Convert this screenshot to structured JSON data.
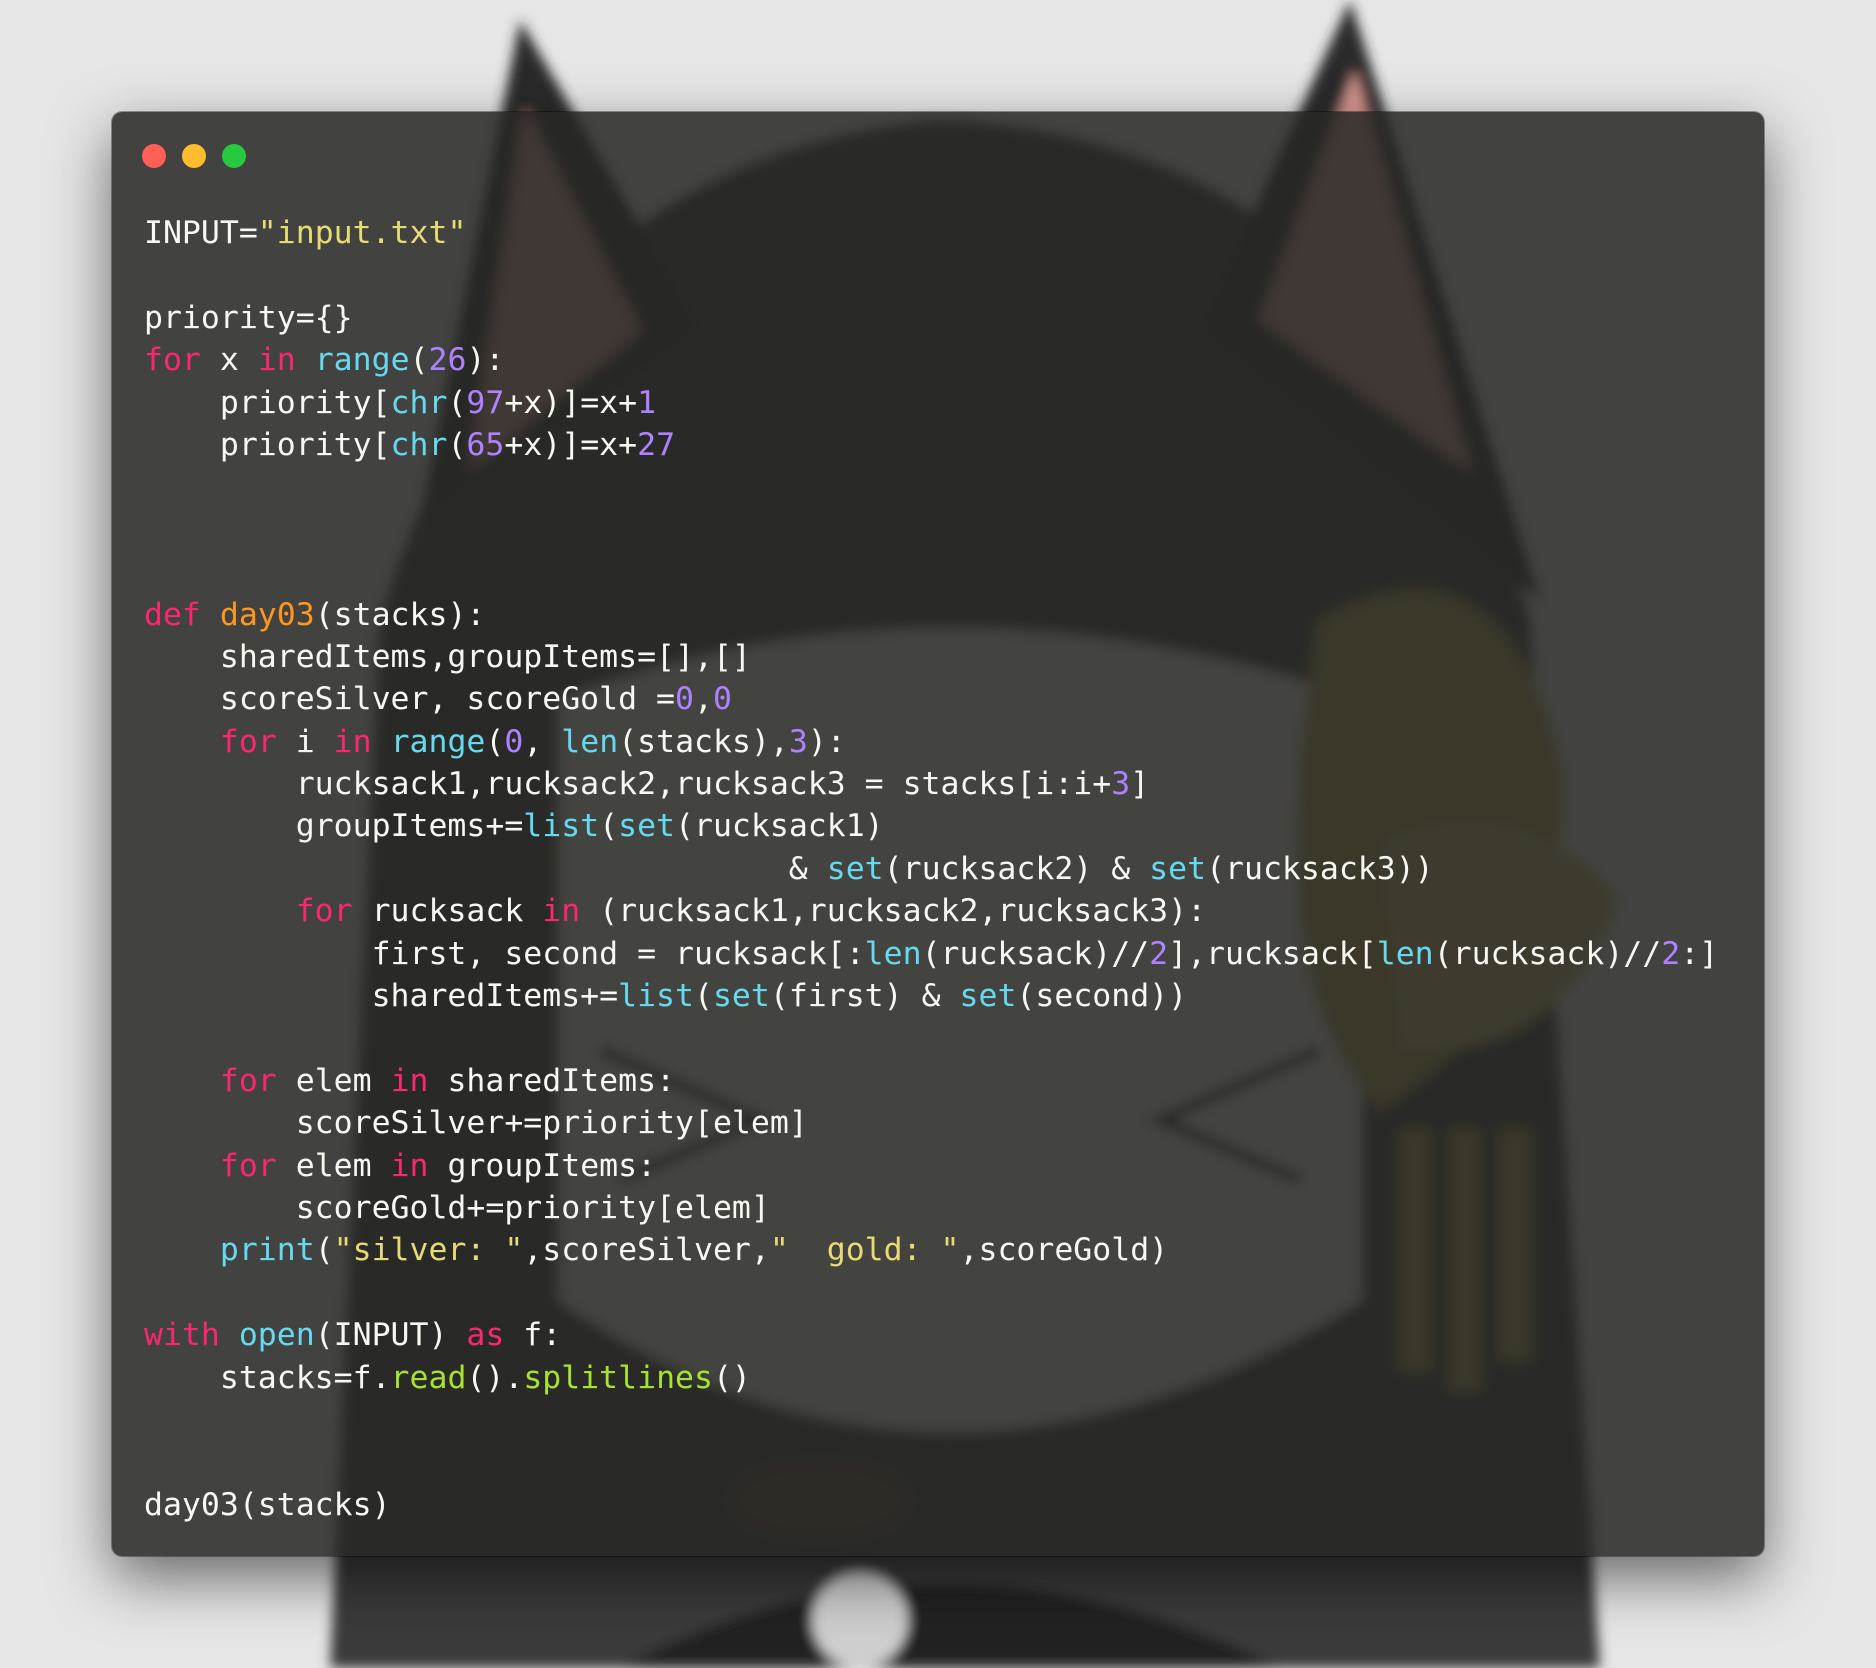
{
  "window": {
    "controls": {
      "close_color": "#ff5f56",
      "minimize_color": "#ffbd2e",
      "maximize_color": "#27c93f"
    }
  },
  "colors": {
    "keyword": "#f92672",
    "function_name": "#fd971f",
    "builtin": "#66d9ef",
    "number": "#ae81ff",
    "string": "#e6db74",
    "method": "#a6e22e",
    "text": "#f8f8f2"
  },
  "code": {
    "language": "python",
    "lines": [
      [
        {
          "t": "plain",
          "s": "INPUT="
        },
        {
          "t": "str",
          "s": "\"input.txt\""
        }
      ],
      [],
      [
        {
          "t": "plain",
          "s": "priority={}"
        }
      ],
      [
        {
          "t": "kw",
          "s": "for"
        },
        {
          "t": "plain",
          "s": " x "
        },
        {
          "t": "kw",
          "s": "in"
        },
        {
          "t": "plain",
          "s": " "
        },
        {
          "t": "bi",
          "s": "range"
        },
        {
          "t": "plain",
          "s": "("
        },
        {
          "t": "num",
          "s": "26"
        },
        {
          "t": "plain",
          "s": "):"
        }
      ],
      [
        {
          "t": "plain",
          "s": "    priority["
        },
        {
          "t": "bi",
          "s": "chr"
        },
        {
          "t": "plain",
          "s": "("
        },
        {
          "t": "num",
          "s": "97"
        },
        {
          "t": "plain",
          "s": "+x)]=x+"
        },
        {
          "t": "num",
          "s": "1"
        }
      ],
      [
        {
          "t": "plain",
          "s": "    priority["
        },
        {
          "t": "bi",
          "s": "chr"
        },
        {
          "t": "plain",
          "s": "("
        },
        {
          "t": "num",
          "s": "65"
        },
        {
          "t": "plain",
          "s": "+x)]=x+"
        },
        {
          "t": "num",
          "s": "27"
        }
      ],
      [],
      [],
      [],
      [
        {
          "t": "kw",
          "s": "def"
        },
        {
          "t": "plain",
          "s": " "
        },
        {
          "t": "fn",
          "s": "day03"
        },
        {
          "t": "plain",
          "s": "(stacks):"
        }
      ],
      [
        {
          "t": "plain",
          "s": "    sharedItems,groupItems=[],[]"
        }
      ],
      [
        {
          "t": "plain",
          "s": "    scoreSilver, scoreGold ="
        },
        {
          "t": "num",
          "s": "0"
        },
        {
          "t": "plain",
          "s": ","
        },
        {
          "t": "num",
          "s": "0"
        }
      ],
      [
        {
          "t": "plain",
          "s": "    "
        },
        {
          "t": "kw",
          "s": "for"
        },
        {
          "t": "plain",
          "s": " i "
        },
        {
          "t": "kw",
          "s": "in"
        },
        {
          "t": "plain",
          "s": " "
        },
        {
          "t": "bi",
          "s": "range"
        },
        {
          "t": "plain",
          "s": "("
        },
        {
          "t": "num",
          "s": "0"
        },
        {
          "t": "plain",
          "s": ", "
        },
        {
          "t": "bi",
          "s": "len"
        },
        {
          "t": "plain",
          "s": "(stacks),"
        },
        {
          "t": "num",
          "s": "3"
        },
        {
          "t": "plain",
          "s": "):"
        }
      ],
      [
        {
          "t": "plain",
          "s": "        rucksack1,rucksack2,rucksack3 = stacks[i:i+"
        },
        {
          "t": "num",
          "s": "3"
        },
        {
          "t": "plain",
          "s": "]"
        }
      ],
      [
        {
          "t": "plain",
          "s": "        groupItems+="
        },
        {
          "t": "bi",
          "s": "list"
        },
        {
          "t": "plain",
          "s": "("
        },
        {
          "t": "bi",
          "s": "set"
        },
        {
          "t": "plain",
          "s": "(rucksack1)"
        }
      ],
      [
        {
          "t": "plain",
          "s": "                                  & "
        },
        {
          "t": "bi",
          "s": "set"
        },
        {
          "t": "plain",
          "s": "(rucksack2) & "
        },
        {
          "t": "bi",
          "s": "set"
        },
        {
          "t": "plain",
          "s": "(rucksack3))"
        }
      ],
      [
        {
          "t": "plain",
          "s": "        "
        },
        {
          "t": "kw",
          "s": "for"
        },
        {
          "t": "plain",
          "s": " rucksack "
        },
        {
          "t": "kw",
          "s": "in"
        },
        {
          "t": "plain",
          "s": " (rucksack1,rucksack2,rucksack3):"
        }
      ],
      [
        {
          "t": "plain",
          "s": "            first, second = rucksack[:"
        },
        {
          "t": "bi",
          "s": "len"
        },
        {
          "t": "plain",
          "s": "(rucksack)//"
        },
        {
          "t": "num",
          "s": "2"
        },
        {
          "t": "plain",
          "s": "],rucksack["
        },
        {
          "t": "bi",
          "s": "len"
        },
        {
          "t": "plain",
          "s": "(rucksack)//"
        },
        {
          "t": "num",
          "s": "2"
        },
        {
          "t": "plain",
          "s": ":]"
        }
      ],
      [
        {
          "t": "plain",
          "s": "            sharedItems+="
        },
        {
          "t": "bi",
          "s": "list"
        },
        {
          "t": "plain",
          "s": "("
        },
        {
          "t": "bi",
          "s": "set"
        },
        {
          "t": "plain",
          "s": "(first) & "
        },
        {
          "t": "bi",
          "s": "set"
        },
        {
          "t": "plain",
          "s": "(second))"
        }
      ],
      [],
      [
        {
          "t": "plain",
          "s": "    "
        },
        {
          "t": "kw",
          "s": "for"
        },
        {
          "t": "plain",
          "s": " elem "
        },
        {
          "t": "kw",
          "s": "in"
        },
        {
          "t": "plain",
          "s": " sharedItems:"
        }
      ],
      [
        {
          "t": "plain",
          "s": "        scoreSilver+=priority[elem]"
        }
      ],
      [
        {
          "t": "plain",
          "s": "    "
        },
        {
          "t": "kw",
          "s": "for"
        },
        {
          "t": "plain",
          "s": " elem "
        },
        {
          "t": "kw",
          "s": "in"
        },
        {
          "t": "plain",
          "s": " groupItems:"
        }
      ],
      [
        {
          "t": "plain",
          "s": "        scoreGold+=priority[elem]"
        }
      ],
      [
        {
          "t": "plain",
          "s": "    "
        },
        {
          "t": "bi",
          "s": "print"
        },
        {
          "t": "plain",
          "s": "("
        },
        {
          "t": "str",
          "s": "\"silver: \""
        },
        {
          "t": "plain",
          "s": ",scoreSilver,"
        },
        {
          "t": "str",
          "s": "\"  gold: \""
        },
        {
          "t": "plain",
          "s": ",scoreGold)"
        }
      ],
      [],
      [
        {
          "t": "kw",
          "s": "with"
        },
        {
          "t": "plain",
          "s": " "
        },
        {
          "t": "bi",
          "s": "open"
        },
        {
          "t": "plain",
          "s": "(INPUT) "
        },
        {
          "t": "kw",
          "s": "as"
        },
        {
          "t": "plain",
          "s": " f:"
        }
      ],
      [
        {
          "t": "plain",
          "s": "    stacks=f."
        },
        {
          "t": "meth",
          "s": "read"
        },
        {
          "t": "plain",
          "s": "()."
        },
        {
          "t": "meth",
          "s": "splitlines"
        },
        {
          "t": "plain",
          "s": "()"
        }
      ],
      [],
      [],
      [
        {
          "t": "plain",
          "s": "day03(stacks)"
        }
      ]
    ]
  }
}
